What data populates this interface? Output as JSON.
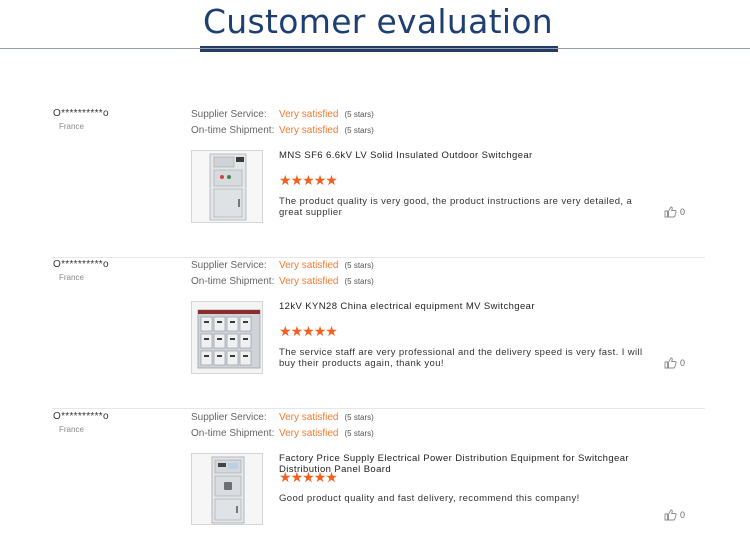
{
  "header": {
    "title": "Customer evaluation"
  },
  "labels": {
    "supplier_service": "Supplier Service:",
    "ontime_shipment": "On-time Shipment:"
  },
  "colors": {
    "accent": "#f47a2c",
    "star": "#f25f1e",
    "title": "#1d3f72"
  },
  "reviews": [
    {
      "user": "O**********o",
      "country": "France",
      "supplier_service": {
        "value": "Very satisfied",
        "stars_text": "(5 stars)"
      },
      "ontime_shipment": {
        "value": "Very satisfied",
        "stars_text": "(5 stars)"
      },
      "product_title": "MNS SF6 6.6kV LV Solid Insulated Outdoor Switchgear",
      "rating": 5,
      "comment": "The product quality is very good, the product instructions are very detailed, a great supplier",
      "likes": "0"
    },
    {
      "user": "O**********o",
      "country": "France",
      "supplier_service": {
        "value": "Very satisfied",
        "stars_text": "(5 stars)"
      },
      "ontime_shipment": {
        "value": "Very satisfied",
        "stars_text": "(5 stars)"
      },
      "product_title": "12kV KYN28 China electrical equipment MV Switchgear",
      "rating": 5,
      "comment": "The service staff are very professional and the delivery speed is very fast. I will buy their products again, thank you!",
      "likes": "0"
    },
    {
      "user": "O**********o",
      "country": "France",
      "supplier_service": {
        "value": "Very satisfied",
        "stars_text": "(5 stars)"
      },
      "ontime_shipment": {
        "value": "Very satisfied",
        "stars_text": "(5 stars)"
      },
      "product_title": "Factory Price Supply Electrical Power Distribution Equipment for Switchgear Distribution Panel Board",
      "rating": 5,
      "comment": "Good product quality and fast delivery, recommend this company!",
      "likes": "0"
    }
  ]
}
